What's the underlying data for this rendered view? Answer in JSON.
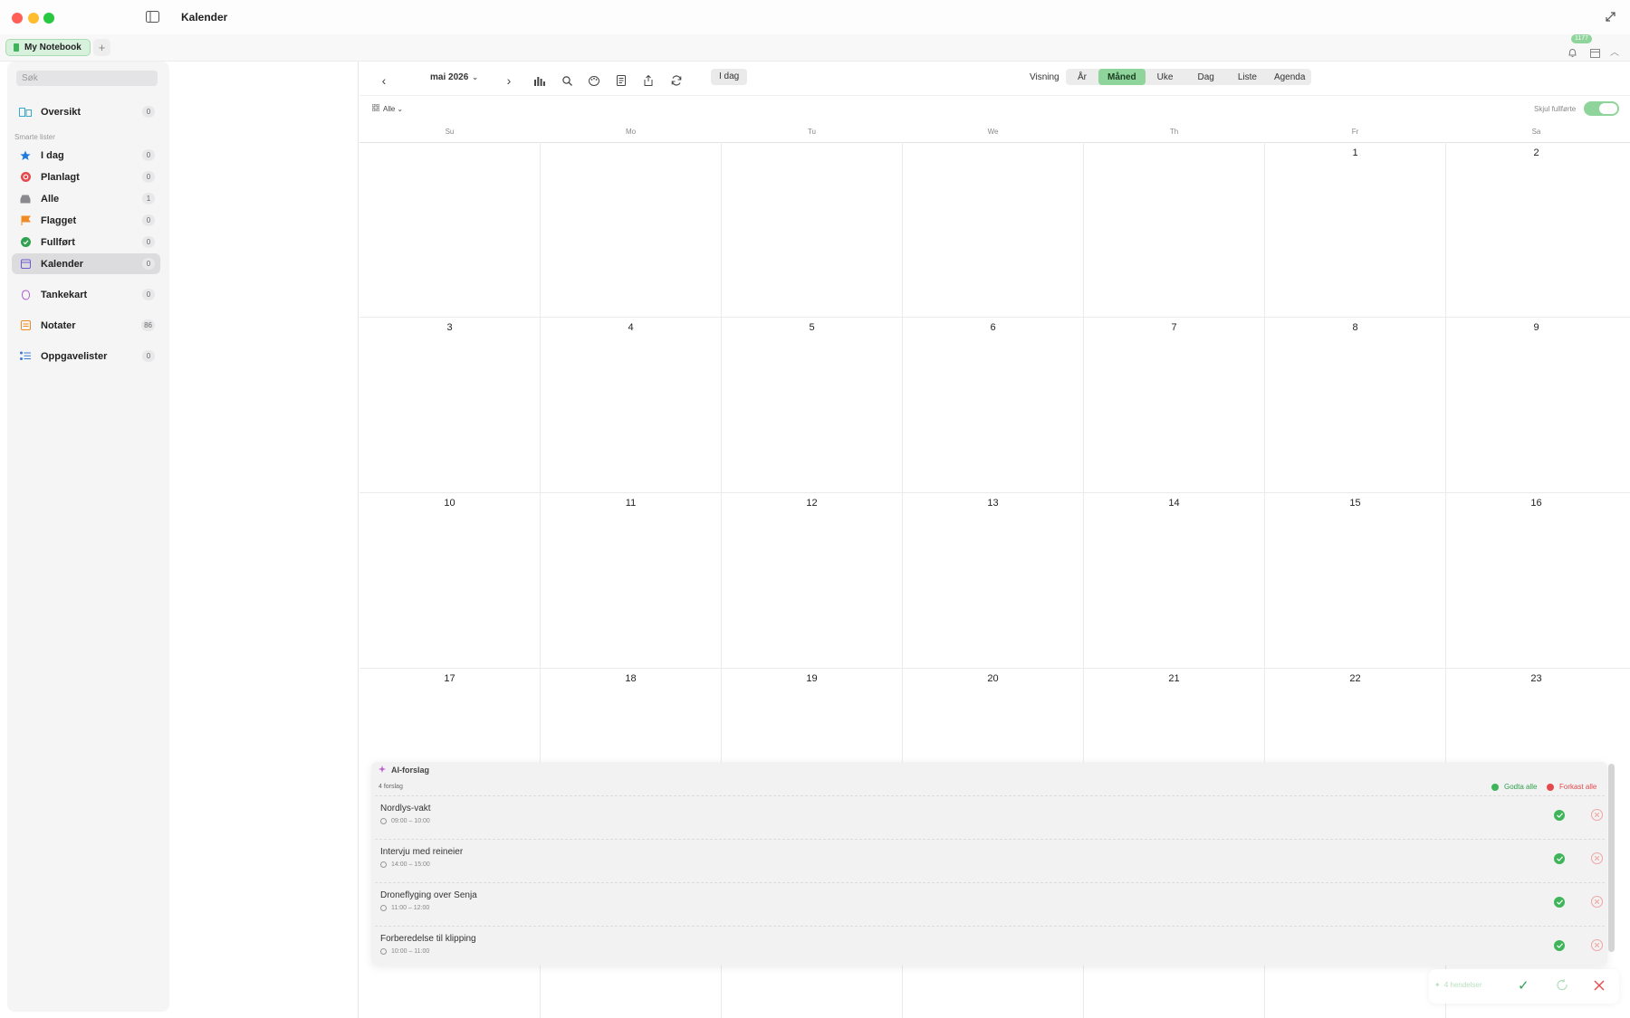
{
  "window": {
    "title": "Kalender"
  },
  "tabs": [
    {
      "label": "My Notebook"
    }
  ],
  "notification_count": "1177",
  "sidebar": {
    "search_placeholder": "Søk",
    "overview": {
      "label": "Oversikt",
      "count": "0"
    },
    "smart_lists_heading": "Smarte lister",
    "items": [
      {
        "label": "I dag",
        "count": "0",
        "icon": "star-icon"
      },
      {
        "label": "Planlagt",
        "count": "0",
        "icon": "scheduled-icon"
      },
      {
        "label": "Alle",
        "count": "1",
        "icon": "inbox-icon"
      },
      {
        "label": "Flagget",
        "count": "0",
        "icon": "flag-icon"
      },
      {
        "label": "Fullført",
        "count": "0",
        "icon": "check-circle-icon"
      },
      {
        "label": "Kalender",
        "count": "0",
        "icon": "calendar-icon"
      }
    ],
    "extra": [
      {
        "label": "Tankekart",
        "count": "0",
        "icon": "mindmap-icon"
      },
      {
        "label": "Notater",
        "count": "86",
        "icon": "notes-icon"
      },
      {
        "label": "Oppgavelister",
        "count": "0",
        "icon": "task-list-icon"
      }
    ]
  },
  "toolbar": {
    "month": "mai 2026",
    "today": "I dag",
    "view_label": "Visning",
    "views": [
      "År",
      "Måned",
      "Uke",
      "Dag",
      "Liste",
      "Agenda"
    ],
    "active_view": "Måned",
    "filter": "Alle",
    "hide_completed": "Skjul fullførte"
  },
  "calendar": {
    "weekdays": [
      "Su",
      "Mo",
      "Tu",
      "We",
      "Th",
      "Fr",
      "Sa"
    ],
    "weeks": [
      [
        "",
        "",
        "",
        "",
        "",
        "1",
        "2"
      ],
      [
        "3",
        "4",
        "5",
        "6",
        "7",
        "8",
        "9"
      ],
      [
        "10",
        "11",
        "12",
        "13",
        "14",
        "15",
        "16"
      ],
      [
        "17",
        "18",
        "19",
        "20",
        "21",
        "22",
        "23"
      ]
    ]
  },
  "ai_panel": {
    "title": "AI-forslag",
    "count_label": "4 forslag",
    "accept_all": "Godta alle",
    "reject_all": "Forkast alle",
    "suggestions": [
      {
        "title": "Nordlys-vakt",
        "time": "09:00 – 10:00"
      },
      {
        "title": "Intervju med reineier",
        "time": "14:00 – 15:00"
      },
      {
        "title": "Droneflyging over Senja",
        "time": "11:00 – 12:00"
      },
      {
        "title": "Forberedelse til klipping",
        "time": "10:00 – 11:00"
      }
    ]
  },
  "bottom_bar": {
    "label": "4 hendelser"
  },
  "colors": {
    "accent": "#8fd49a",
    "accent_strong": "#3fb55a",
    "danger": "#e5484d"
  }
}
